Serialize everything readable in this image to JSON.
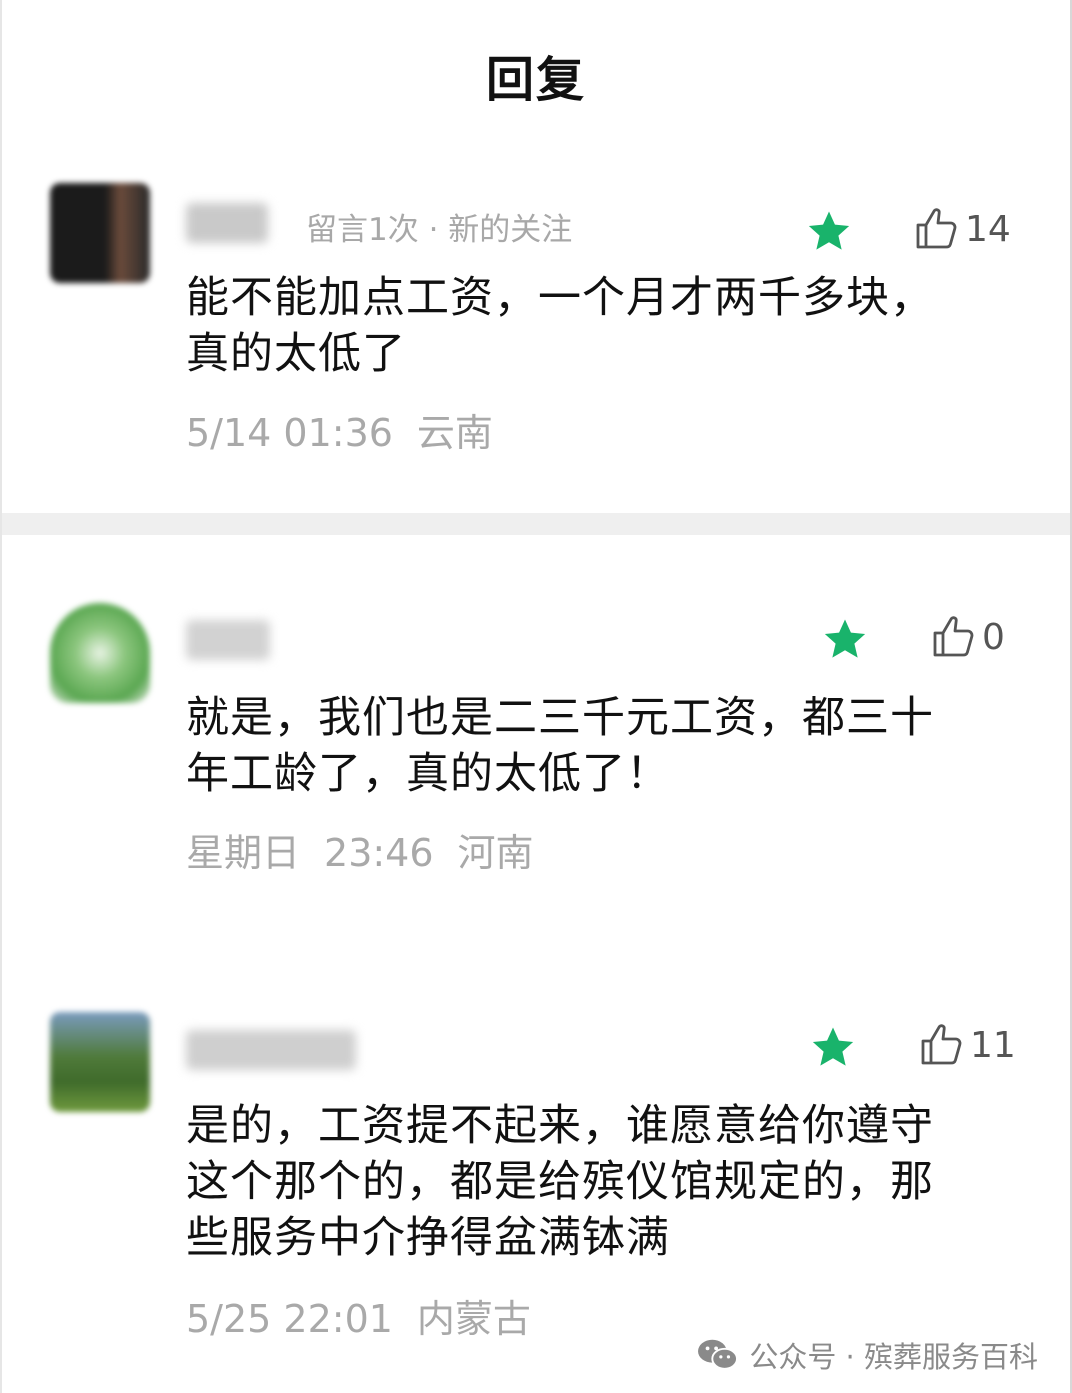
{
  "header": {
    "title": "回复"
  },
  "colors": {
    "accent_star": "#19b36b",
    "meta_gray": "#a8a8a8"
  },
  "comments": [
    {
      "meta": "留言1次 · 新的关注",
      "starred": true,
      "likes": "14",
      "text_lines": [
        "能不能加点工资，一个月才两千多块，",
        "真的太低了"
      ],
      "date": "5/14 01:36",
      "location": "云南"
    },
    {
      "meta": "",
      "starred": true,
      "likes": "0",
      "text_lines": [
        "就是，我们也是二三千元工资，都三十",
        "年工龄了，真的太低了！"
      ],
      "date": "星期日",
      "time": "23:46",
      "location": "河南"
    },
    {
      "meta": "",
      "starred": true,
      "likes": "11",
      "text_lines": [
        "是的，工资提不起来，谁愿意给你遵守",
        "这个那个的，都是给殡仪馆规定的，那",
        "些服务中介挣得盆满钵满"
      ],
      "date": "5/25 22:01",
      "location": "内蒙古"
    }
  ],
  "watermark": {
    "text": "公众号 · 殡葬服务百科",
    "icon": "wechat-icon"
  }
}
